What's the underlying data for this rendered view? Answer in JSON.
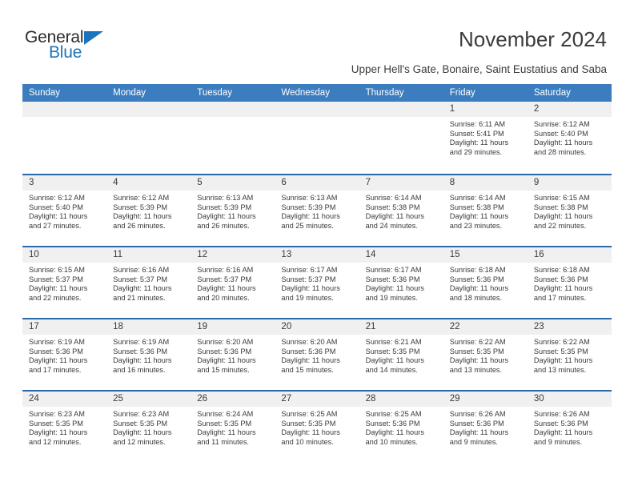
{
  "brand": {
    "name_part1": "General",
    "name_part2": "Blue",
    "triangle_color": "#1b74bb",
    "text_color": "#2b2b2b"
  },
  "header": {
    "title": "November 2024",
    "subtitle": "Upper Hell's Gate, Bonaire, Saint Eustatius and Saba",
    "accent_color": "#3b7dbe",
    "row_divider_color": "#2a6aa8",
    "daynum_band_color": "#f0f0f0"
  },
  "weekdays": [
    "Sunday",
    "Monday",
    "Tuesday",
    "Wednesday",
    "Thursday",
    "Friday",
    "Saturday"
  ],
  "weeks": [
    [
      {
        "day": ""
      },
      {
        "day": ""
      },
      {
        "day": ""
      },
      {
        "day": ""
      },
      {
        "day": ""
      },
      {
        "day": "1",
        "sunrise": "Sunrise: 6:11 AM",
        "sunset": "Sunset: 5:41 PM",
        "daylight_l1": "Daylight: 11 hours",
        "daylight_l2": "and 29 minutes."
      },
      {
        "day": "2",
        "sunrise": "Sunrise: 6:12 AM",
        "sunset": "Sunset: 5:40 PM",
        "daylight_l1": "Daylight: 11 hours",
        "daylight_l2": "and 28 minutes."
      }
    ],
    [
      {
        "day": "3",
        "sunrise": "Sunrise: 6:12 AM",
        "sunset": "Sunset: 5:40 PM",
        "daylight_l1": "Daylight: 11 hours",
        "daylight_l2": "and 27 minutes."
      },
      {
        "day": "4",
        "sunrise": "Sunrise: 6:12 AM",
        "sunset": "Sunset: 5:39 PM",
        "daylight_l1": "Daylight: 11 hours",
        "daylight_l2": "and 26 minutes."
      },
      {
        "day": "5",
        "sunrise": "Sunrise: 6:13 AM",
        "sunset": "Sunset: 5:39 PM",
        "daylight_l1": "Daylight: 11 hours",
        "daylight_l2": "and 26 minutes."
      },
      {
        "day": "6",
        "sunrise": "Sunrise: 6:13 AM",
        "sunset": "Sunset: 5:39 PM",
        "daylight_l1": "Daylight: 11 hours",
        "daylight_l2": "and 25 minutes."
      },
      {
        "day": "7",
        "sunrise": "Sunrise: 6:14 AM",
        "sunset": "Sunset: 5:38 PM",
        "daylight_l1": "Daylight: 11 hours",
        "daylight_l2": "and 24 minutes."
      },
      {
        "day": "8",
        "sunrise": "Sunrise: 6:14 AM",
        "sunset": "Sunset: 5:38 PM",
        "daylight_l1": "Daylight: 11 hours",
        "daylight_l2": "and 23 minutes."
      },
      {
        "day": "9",
        "sunrise": "Sunrise: 6:15 AM",
        "sunset": "Sunset: 5:38 PM",
        "daylight_l1": "Daylight: 11 hours",
        "daylight_l2": "and 22 minutes."
      }
    ],
    [
      {
        "day": "10",
        "sunrise": "Sunrise: 6:15 AM",
        "sunset": "Sunset: 5:37 PM",
        "daylight_l1": "Daylight: 11 hours",
        "daylight_l2": "and 22 minutes."
      },
      {
        "day": "11",
        "sunrise": "Sunrise: 6:16 AM",
        "sunset": "Sunset: 5:37 PM",
        "daylight_l1": "Daylight: 11 hours",
        "daylight_l2": "and 21 minutes."
      },
      {
        "day": "12",
        "sunrise": "Sunrise: 6:16 AM",
        "sunset": "Sunset: 5:37 PM",
        "daylight_l1": "Daylight: 11 hours",
        "daylight_l2": "and 20 minutes."
      },
      {
        "day": "13",
        "sunrise": "Sunrise: 6:17 AM",
        "sunset": "Sunset: 5:37 PM",
        "daylight_l1": "Daylight: 11 hours",
        "daylight_l2": "and 19 minutes."
      },
      {
        "day": "14",
        "sunrise": "Sunrise: 6:17 AM",
        "sunset": "Sunset: 5:36 PM",
        "daylight_l1": "Daylight: 11 hours",
        "daylight_l2": "and 19 minutes."
      },
      {
        "day": "15",
        "sunrise": "Sunrise: 6:18 AM",
        "sunset": "Sunset: 5:36 PM",
        "daylight_l1": "Daylight: 11 hours",
        "daylight_l2": "and 18 minutes."
      },
      {
        "day": "16",
        "sunrise": "Sunrise: 6:18 AM",
        "sunset": "Sunset: 5:36 PM",
        "daylight_l1": "Daylight: 11 hours",
        "daylight_l2": "and 17 minutes."
      }
    ],
    [
      {
        "day": "17",
        "sunrise": "Sunrise: 6:19 AM",
        "sunset": "Sunset: 5:36 PM",
        "daylight_l1": "Daylight: 11 hours",
        "daylight_l2": "and 17 minutes."
      },
      {
        "day": "18",
        "sunrise": "Sunrise: 6:19 AM",
        "sunset": "Sunset: 5:36 PM",
        "daylight_l1": "Daylight: 11 hours",
        "daylight_l2": "and 16 minutes."
      },
      {
        "day": "19",
        "sunrise": "Sunrise: 6:20 AM",
        "sunset": "Sunset: 5:36 PM",
        "daylight_l1": "Daylight: 11 hours",
        "daylight_l2": "and 15 minutes."
      },
      {
        "day": "20",
        "sunrise": "Sunrise: 6:20 AM",
        "sunset": "Sunset: 5:36 PM",
        "daylight_l1": "Daylight: 11 hours",
        "daylight_l2": "and 15 minutes."
      },
      {
        "day": "21",
        "sunrise": "Sunrise: 6:21 AM",
        "sunset": "Sunset: 5:35 PM",
        "daylight_l1": "Daylight: 11 hours",
        "daylight_l2": "and 14 minutes."
      },
      {
        "day": "22",
        "sunrise": "Sunrise: 6:22 AM",
        "sunset": "Sunset: 5:35 PM",
        "daylight_l1": "Daylight: 11 hours",
        "daylight_l2": "and 13 minutes."
      },
      {
        "day": "23",
        "sunrise": "Sunrise: 6:22 AM",
        "sunset": "Sunset: 5:35 PM",
        "daylight_l1": "Daylight: 11 hours",
        "daylight_l2": "and 13 minutes."
      }
    ],
    [
      {
        "day": "24",
        "sunrise": "Sunrise: 6:23 AM",
        "sunset": "Sunset: 5:35 PM",
        "daylight_l1": "Daylight: 11 hours",
        "daylight_l2": "and 12 minutes."
      },
      {
        "day": "25",
        "sunrise": "Sunrise: 6:23 AM",
        "sunset": "Sunset: 5:35 PM",
        "daylight_l1": "Daylight: 11 hours",
        "daylight_l2": "and 12 minutes."
      },
      {
        "day": "26",
        "sunrise": "Sunrise: 6:24 AM",
        "sunset": "Sunset: 5:35 PM",
        "daylight_l1": "Daylight: 11 hours",
        "daylight_l2": "and 11 minutes."
      },
      {
        "day": "27",
        "sunrise": "Sunrise: 6:25 AM",
        "sunset": "Sunset: 5:35 PM",
        "daylight_l1": "Daylight: 11 hours",
        "daylight_l2": "and 10 minutes."
      },
      {
        "day": "28",
        "sunrise": "Sunrise: 6:25 AM",
        "sunset": "Sunset: 5:36 PM",
        "daylight_l1": "Daylight: 11 hours",
        "daylight_l2": "and 10 minutes."
      },
      {
        "day": "29",
        "sunrise": "Sunrise: 6:26 AM",
        "sunset": "Sunset: 5:36 PM",
        "daylight_l1": "Daylight: 11 hours",
        "daylight_l2": "and 9 minutes."
      },
      {
        "day": "30",
        "sunrise": "Sunrise: 6:26 AM",
        "sunset": "Sunset: 5:36 PM",
        "daylight_l1": "Daylight: 11 hours",
        "daylight_l2": "and 9 minutes."
      }
    ]
  ]
}
